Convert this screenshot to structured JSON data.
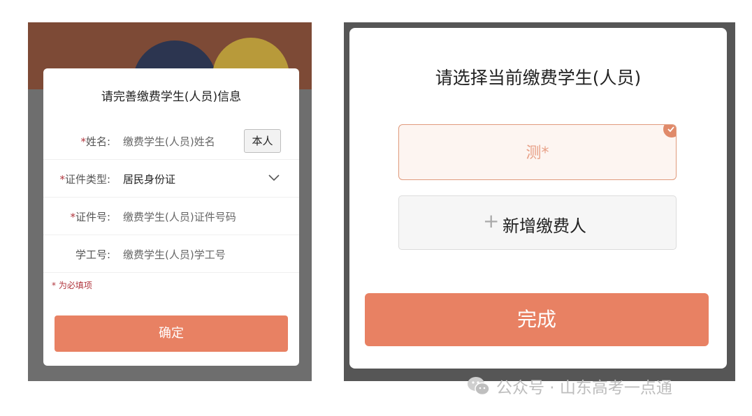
{
  "left_form": {
    "title": "请完善缴费学生(人员)信息",
    "fields": [
      {
        "label": "姓名:",
        "required": true,
        "value": "缴费学生(人员)姓名",
        "filled": false
      },
      {
        "label": "证件类型:",
        "required": true,
        "value": "居民身份证",
        "filled": true
      },
      {
        "label": "证件号:",
        "required": true,
        "value": "缴费学生(人员)证件号码",
        "filled": false
      },
      {
        "label": "学工号:",
        "required": false,
        "value": "缴费学生(人员)学工号",
        "filled": false
      }
    ],
    "required_mark": "*",
    "self_button": "本人",
    "required_note": "* 为必填项",
    "confirm_button": "确定"
  },
  "right_panel": {
    "title": "请选择当前缴费学生(人员)",
    "selected_person": "测*",
    "add_button": "新增缴费人",
    "add_icon": "+",
    "done_button": "完成"
  },
  "watermark": {
    "text": "公众号 · 山东高考一点通",
    "icon": "wechat-icon"
  },
  "colors": {
    "accent": "#e88163",
    "required": "#b0353d",
    "selected_border": "#e09a7c"
  }
}
